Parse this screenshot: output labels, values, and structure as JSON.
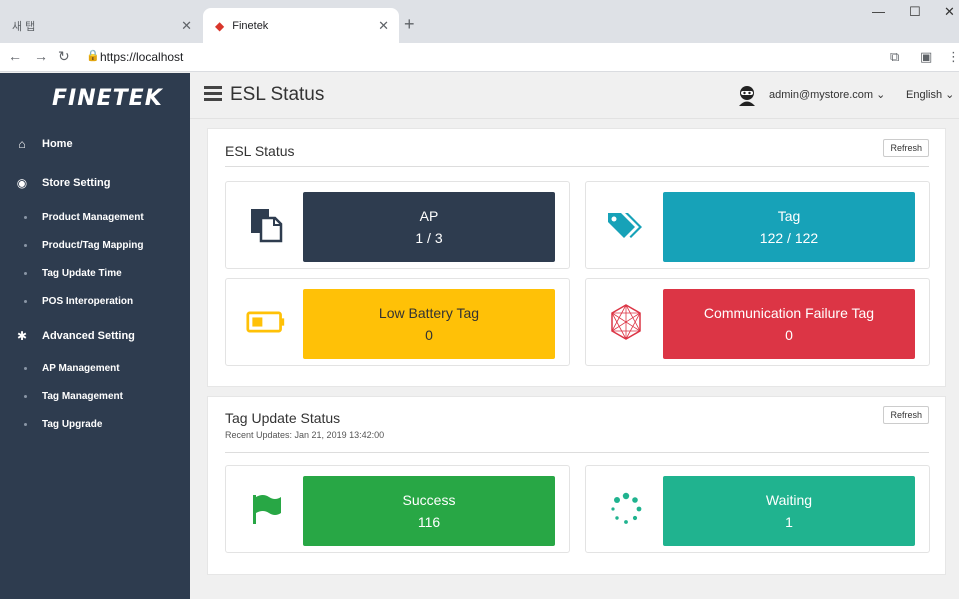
{
  "browser": {
    "inactive_tab": "새 탭",
    "active_tab": "Finetek",
    "url": "https://localhost"
  },
  "sidebar": {
    "logo": "FINETEK",
    "home": "Home",
    "store_setting": "Store Setting",
    "store_items": [
      "Product Management",
      "Product/Tag Mapping",
      "Tag Update Time",
      "POS Interoperation"
    ],
    "advanced_setting": "Advanced Setting",
    "advanced_items": [
      "AP Management",
      "Tag Management",
      "Tag Upgrade"
    ]
  },
  "header": {
    "title": "ESL Status",
    "user": "admin@mystore.com",
    "language": "English"
  },
  "esl_panel": {
    "title": "ESL Status",
    "refresh": "Refresh",
    "cards": [
      {
        "label": "AP",
        "value": "1 / 3",
        "color": "#2e3c4f",
        "icon": "ap-device-icon"
      },
      {
        "label": "Tag",
        "value": "122 / 122",
        "color": "#17a2b8",
        "icon": "tag-icon"
      },
      {
        "label": "Low Battery Tag",
        "value": "0",
        "color": "#ffc107",
        "icon": "battery-low-icon"
      },
      {
        "label": "Communication Failure Tag",
        "value": "0",
        "color": "#dc3545",
        "icon": "network-failure-icon"
      }
    ]
  },
  "update_panel": {
    "title": "Tag Update Status",
    "subtitle": "Recent Updates: Jan 21, 2019 13:42:00",
    "refresh": "Refresh",
    "cards": [
      {
        "label": "Success",
        "value": "116",
        "color": "#28a745",
        "icon": "flag-icon"
      },
      {
        "label": "Waiting",
        "value": "1",
        "color": "#20b38f",
        "icon": "spinner-icon"
      }
    ]
  }
}
